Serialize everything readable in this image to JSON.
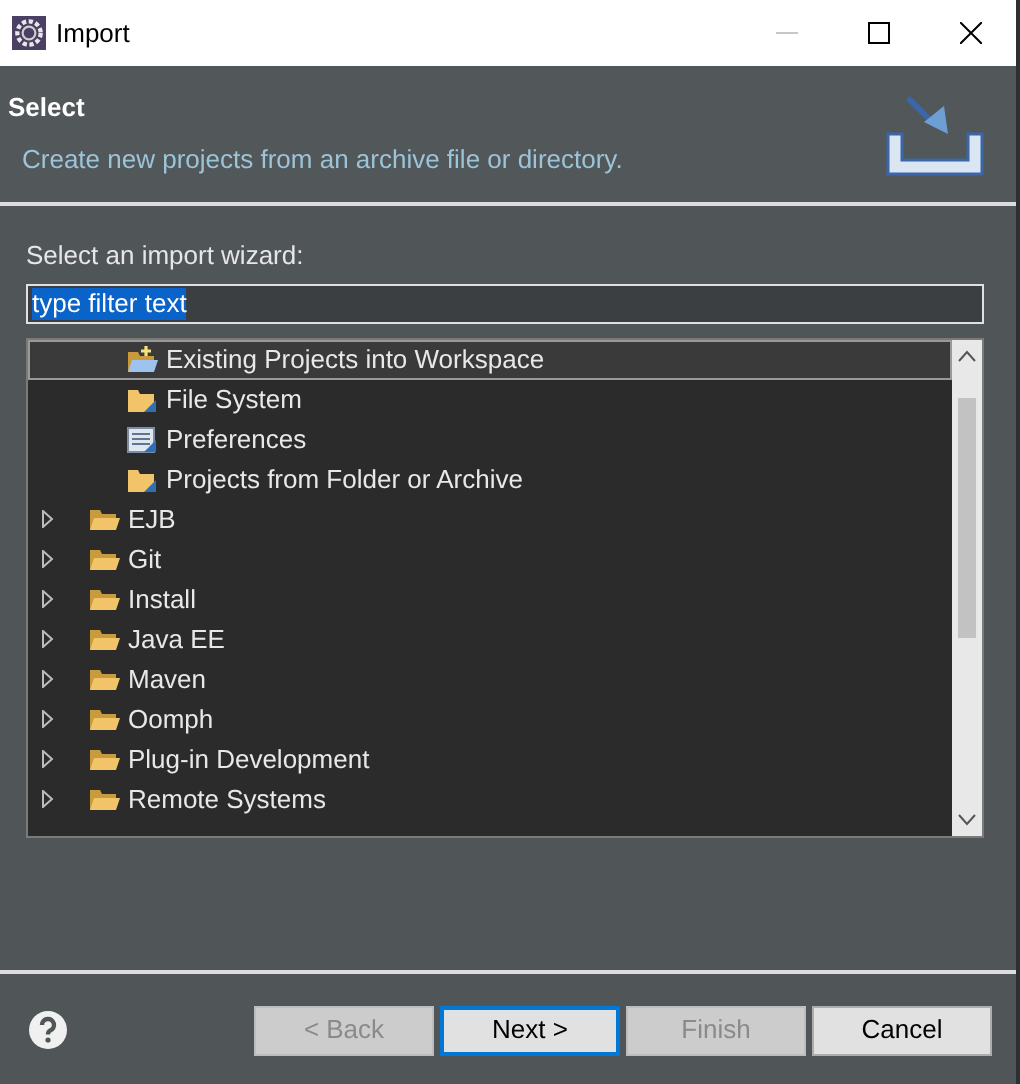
{
  "window": {
    "title": "Import"
  },
  "header": {
    "title": "Select",
    "description": "Create new projects from an archive file or directory."
  },
  "wizard_label": "Select an import wizard:",
  "filter": {
    "value": "type filter text",
    "text_selected": true
  },
  "tree": {
    "items": [
      {
        "kind": "wizard",
        "label": "Existing Projects into Workspace",
        "selected": true
      },
      {
        "kind": "wizard",
        "label": "File System",
        "selected": false
      },
      {
        "kind": "wizard",
        "label": "Preferences",
        "selected": false
      },
      {
        "kind": "wizard",
        "label": "Projects from Folder or Archive",
        "selected": false
      },
      {
        "kind": "category",
        "label": "EJB",
        "expanded": false,
        "selected": false
      },
      {
        "kind": "category",
        "label": "Git",
        "expanded": false,
        "selected": false
      },
      {
        "kind": "category",
        "label": "Install",
        "expanded": false,
        "selected": false
      },
      {
        "kind": "category",
        "label": "Java EE",
        "expanded": false,
        "selected": false
      },
      {
        "kind": "category",
        "label": "Maven",
        "expanded": false,
        "selected": false
      },
      {
        "kind": "category",
        "label": "Oomph",
        "expanded": false,
        "selected": false
      },
      {
        "kind": "category",
        "label": "Plug-in Development",
        "expanded": false,
        "selected": false
      },
      {
        "kind": "category",
        "label": "Remote Systems",
        "expanded": false,
        "selected": false
      }
    ]
  },
  "buttons": [
    {
      "label": "< Back",
      "disabled": true,
      "default": false
    },
    {
      "label": "Next >",
      "disabled": false,
      "default": true
    },
    {
      "label": "Finish",
      "disabled": true,
      "default": false
    },
    {
      "label": "Cancel",
      "disabled": false,
      "default": false
    }
  ]
}
